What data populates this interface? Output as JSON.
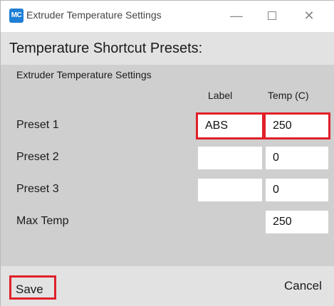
{
  "window": {
    "app_icon": "MC",
    "title": "Extruder Temperature Settings",
    "minimize_symbol": "—",
    "close_symbol": "✕"
  },
  "dialog": {
    "heading": "Temperature Shortcut Presets:",
    "group_label": "Extruder Temperature Settings",
    "columns": {
      "label": "Label",
      "temp": "Temp (C)"
    },
    "presets": [
      {
        "name": "Preset 1",
        "label_value": "ABS",
        "temp_value": "250"
      },
      {
        "name": "Preset 2",
        "label_value": "",
        "temp_value": "0"
      },
      {
        "name": "Preset 3",
        "label_value": "",
        "temp_value": "0"
      }
    ],
    "max_temp": {
      "name": "Max Temp",
      "value": "250"
    }
  },
  "footer": {
    "save_label": "Save",
    "cancel_label": "Cancel"
  },
  "colors": {
    "highlight": "#e0202a",
    "app_icon_bg": "#1e7fd6"
  }
}
